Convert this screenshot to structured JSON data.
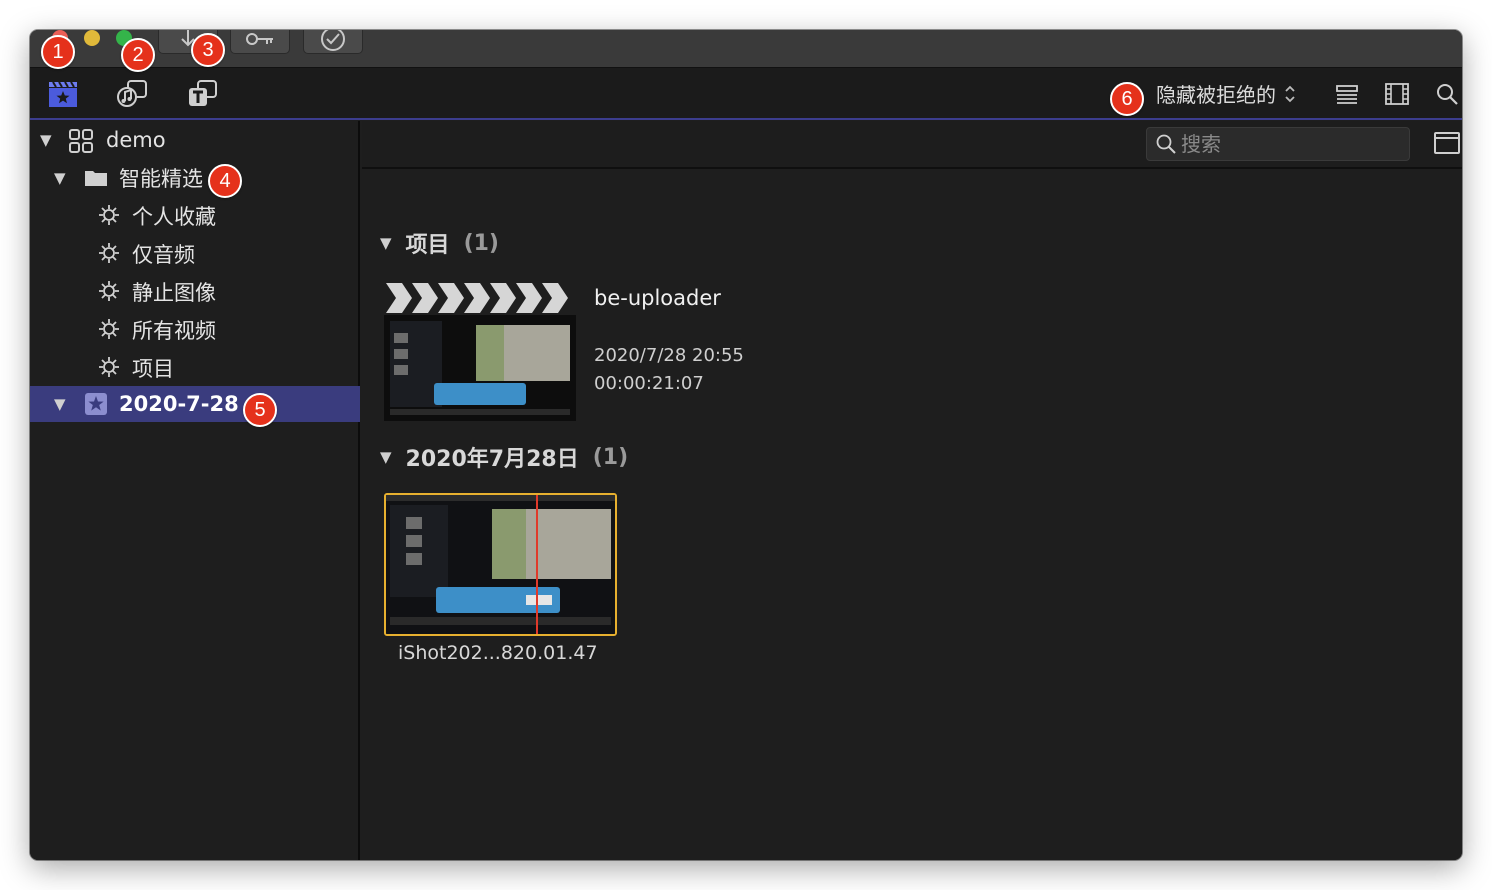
{
  "toolbar": {
    "filter_label": "隐藏被拒绝的"
  },
  "search": {
    "placeholder": "搜索"
  },
  "sidebar": {
    "library": "demo",
    "smart_folder": "智能精选",
    "smart_items": [
      "个人收藏",
      "仅音频",
      "静止图像",
      "所有视频",
      "项目"
    ],
    "event": "2020-7-28"
  },
  "main": {
    "projects_section": {
      "title": "项目",
      "count": "(1)"
    },
    "project": {
      "name": "be-uploader",
      "date": "2020/7/28 20:55",
      "duration": "00:00:21:07"
    },
    "event_section": {
      "title": "2020年7月28日",
      "count": "(1)"
    },
    "clip": {
      "name": "iShot202...820.01.47"
    }
  },
  "callouts": [
    "1",
    "2",
    "3",
    "4",
    "5",
    "6"
  ],
  "colors": {
    "accent": "#3a3c7e",
    "selection_border": "#e7b02f",
    "callout": "#e5311b"
  },
  "icons": [
    "import-arrow-icon",
    "key-icon",
    "checkmark-circle-icon",
    "libraries-icon",
    "photos-audio-icon",
    "titles-icon",
    "list-view-icon",
    "filmstrip-icon",
    "search-icon",
    "library-grid-icon",
    "folder-icon",
    "gear-icon",
    "star-event-icon",
    "browser-panel-icon"
  ]
}
